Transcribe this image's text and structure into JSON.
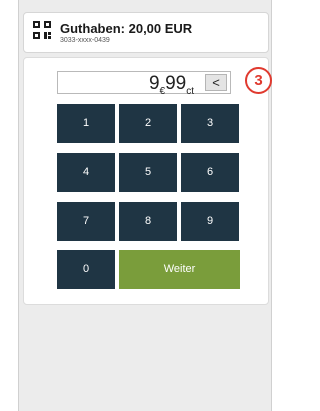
{
  "header": {
    "title": "Guthaben: 20,00 EUR",
    "subtitle": "3033-xxxx-0439",
    "icon": "qr-code-icon"
  },
  "display": {
    "euros": "9",
    "euro_symbol": "€",
    "cents": "99",
    "cent_unit": "ct",
    "back_symbol": "<"
  },
  "keypad": {
    "keys": [
      "1",
      "2",
      "3",
      "4",
      "5",
      "6",
      "7",
      "8",
      "9",
      "0"
    ],
    "continue_label": "Weiter"
  },
  "callout": {
    "number": "3"
  },
  "colors": {
    "key_bg": "#1f3544",
    "continue_bg": "#7a9d3b",
    "callout": "#e03a2f"
  }
}
